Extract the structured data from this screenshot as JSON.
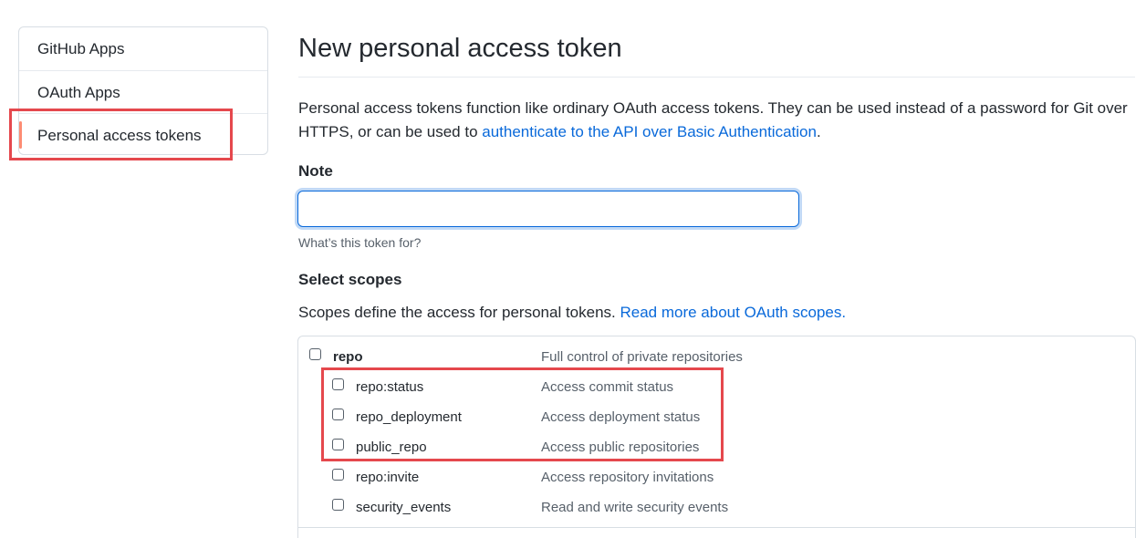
{
  "sidebar": {
    "items": [
      {
        "label": "GitHub Apps"
      },
      {
        "label": "OAuth Apps"
      },
      {
        "label": "Personal access tokens"
      }
    ]
  },
  "main": {
    "title": "New personal access token",
    "description_pre": "Personal access tokens function like ordinary OAuth access tokens. They can be used instead of a password for Git over HTTPS, or can be used to ",
    "description_link": "authenticate to the API over Basic Authentication",
    "description_post": ".",
    "note": {
      "label": "Note",
      "value": "",
      "hint": "What’s this token for?"
    },
    "scopes": {
      "label": "Select scopes",
      "description_pre": "Scopes define the access for personal tokens. ",
      "description_link": "Read more about OAuth scopes.",
      "items": [
        {
          "name": "repo",
          "description": "Full control of private repositories",
          "checked": false
        },
        {
          "name": "repo:status",
          "description": "Access commit status",
          "checked": false
        },
        {
          "name": "repo_deployment",
          "description": "Access deployment status",
          "checked": false
        },
        {
          "name": "public_repo",
          "description": "Access public repositories",
          "checked": false
        },
        {
          "name": "repo:invite",
          "description": "Access repository invitations",
          "checked": false
        },
        {
          "name": "security_events",
          "description": "Read and write security events",
          "checked": false
        }
      ]
    }
  },
  "colors": {
    "link": "#0969da",
    "highlight": "#e5484d",
    "selected_bar": "#fd8c73"
  }
}
